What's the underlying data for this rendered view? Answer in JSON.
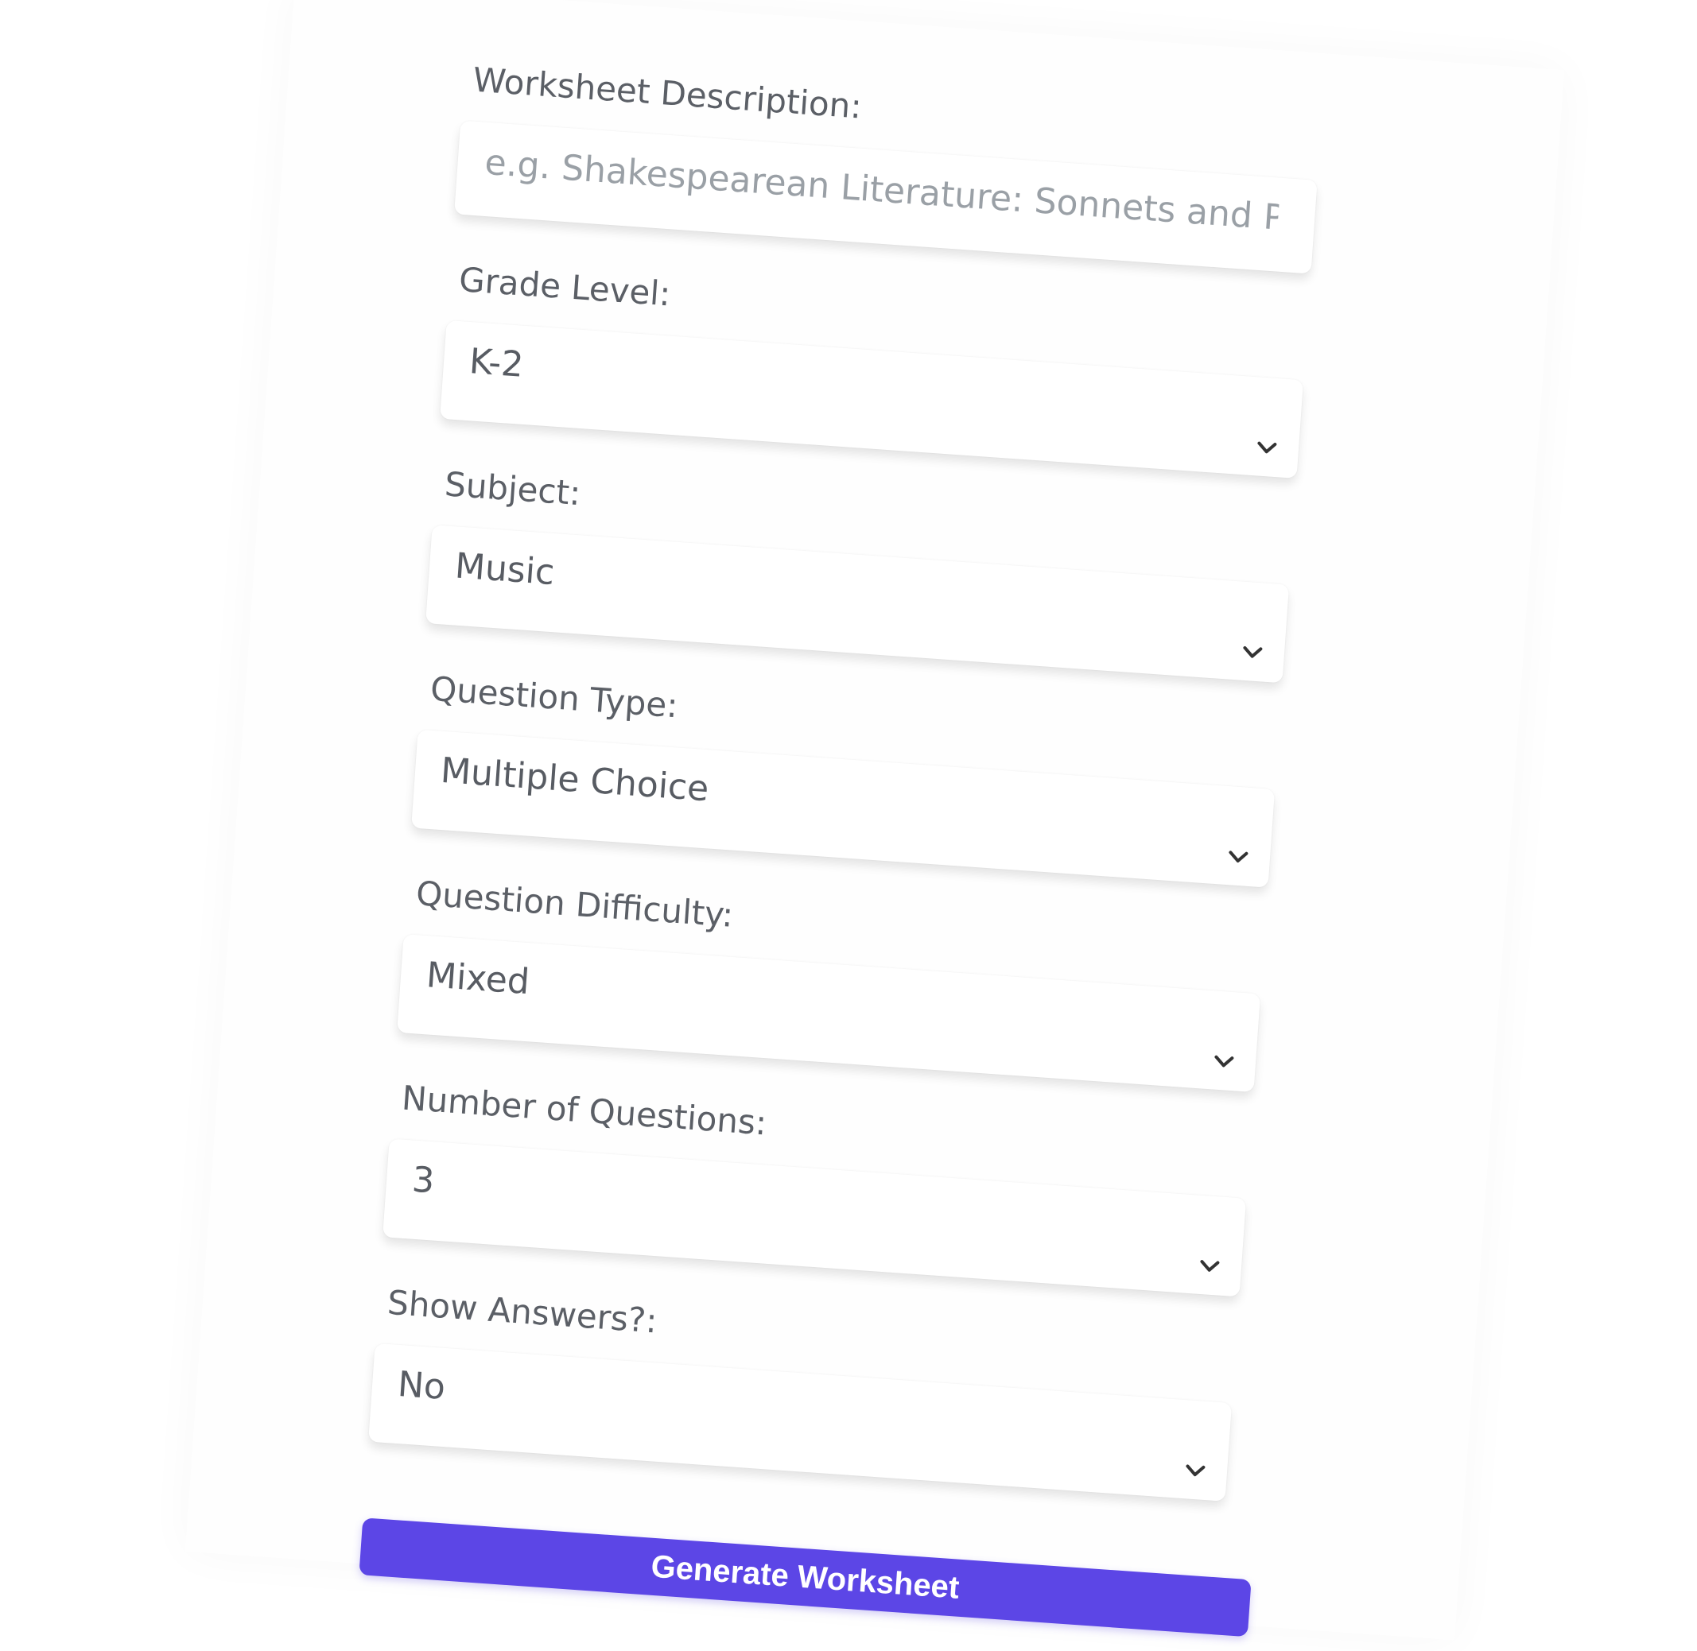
{
  "form": {
    "worksheet_description": {
      "label": "Worksheet Description:",
      "placeholder": "e.g. Shakespearean Literature: Sonnets and Plays",
      "value": ""
    },
    "grade_level": {
      "label": "Grade Level:",
      "value": "K-2"
    },
    "subject": {
      "label": "Subject:",
      "value": "Music"
    },
    "question_type": {
      "label": "Question Type:",
      "value": "Multiple Choice"
    },
    "question_difficulty": {
      "label": "Question Difficulty:",
      "value": "Mixed"
    },
    "number_of_questions": {
      "label": "Number of Questions:",
      "value": "3"
    },
    "show_answers": {
      "label": "Show Answers?:",
      "value": "No"
    },
    "submit_label": "Generate Worksheet"
  },
  "colors": {
    "primary_button": "#5c46e6",
    "label_text": "#5b5f66",
    "placeholder_text": "#9aa0a6"
  },
  "icons": {
    "select_arrow": "chevron-down-icon"
  }
}
